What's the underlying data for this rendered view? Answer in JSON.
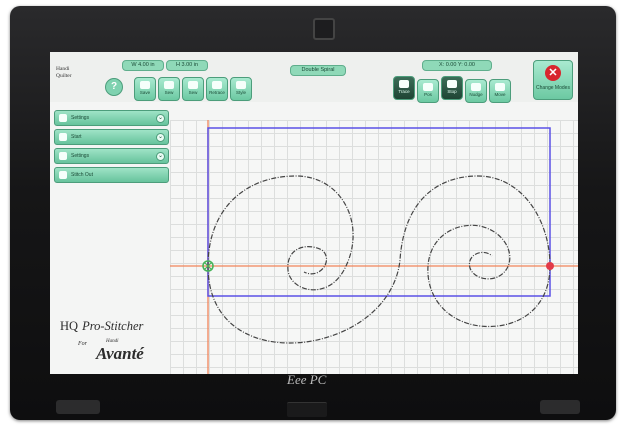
{
  "topbar": {
    "dim_w": "W 4.00 in",
    "dim_h": "H 3.00 in",
    "status": "Double Spiral",
    "coords": "X: 0.00  Y: 0.00"
  },
  "logo": {
    "line1": "Handi",
    "line2": "Quilter"
  },
  "toolbar": {
    "btn_a": "Save",
    "btn_b": "Sew",
    "btn_c": "Sew",
    "btn_d": "Retrace",
    "btn_e": "Style",
    "btn_f": "Trace",
    "btn_g": "Pos",
    "btn_h": "Stop",
    "btn_i": "Nudge",
    "btn_j": "Move",
    "exit_label": "Change Modes"
  },
  "sidebar": {
    "items": [
      {
        "label": "Settings"
      },
      {
        "label": "Start"
      },
      {
        "label": "Settings"
      },
      {
        "label": "Stitch Out"
      }
    ]
  },
  "brand": {
    "line1": "HQ",
    "line2": "Pro-Stitcher",
    "for": "For",
    "small": "Handi",
    "model": "Avanté"
  },
  "device": {
    "brand": "Eee PC"
  },
  "colors": {
    "accent": "#7fd2b0",
    "frame": "#5a50e6",
    "guide": "#f1845a",
    "end": "#e23a48",
    "start": "#48b45a"
  }
}
